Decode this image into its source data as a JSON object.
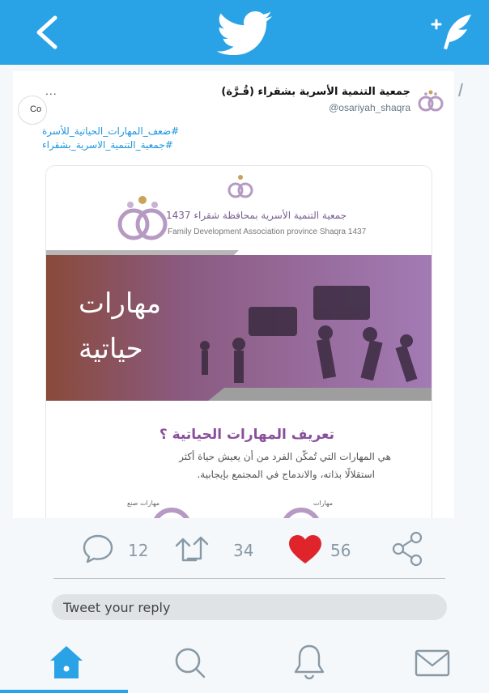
{
  "colors": {
    "brand": "#2aa3e6",
    "link": "#1b95e0",
    "like": "#e0242c",
    "muted": "#8899a6",
    "accent_purple": "#8a4f9c"
  },
  "header": {
    "back_icon": "chevron-left-icon",
    "logo_icon": "twitter-bird-icon",
    "compose_icon": "compose-tweet-icon"
  },
  "tweet": {
    "display_name": "جمعية التنمية الأسرية بشقراء (قُـرَّة)",
    "handle": "@osariyah_shaqra",
    "more": "...",
    "side_logo_text": "Co",
    "hashtags": [
      "#ضعف_المهارات_الحياتية_للأسرة",
      "#جمعية_التنمية_الاسرية_بشقراء"
    ],
    "image": {
      "org_name_ar": "جمعية التنمية الأسرية بمحافظة شقراء 1437",
      "org_name_en": "Family Development Association province Shaqra 1437",
      "banner_line1": "مهارات",
      "banner_line2": "حياتية",
      "definition_title": "تعريف المهارات الحياتية ؟",
      "definition_line1": "هي المهارات التي تُمكّن الفرد من أن يعيش حياة أكثر",
      "definition_line2": "استقلالًا بذاته، والاندماج في المجتمع بإيجابية.",
      "skill_left": "مهارات صنع",
      "skill_right": "مهارات"
    }
  },
  "actions": {
    "reply_count": "12",
    "retweet_count": "34",
    "like_count": "56",
    "reply_icon": "reply-bubble-icon",
    "retweet_icon": "retweet-icon",
    "like_icon": "heart-icon",
    "share_icon": "share-icon"
  },
  "reply_box": {
    "placeholder": "Tweet your reply"
  },
  "bottom_nav": {
    "items": [
      "home-icon",
      "search-icon",
      "notifications-icon",
      "messages-icon"
    ],
    "active": "home-icon"
  }
}
